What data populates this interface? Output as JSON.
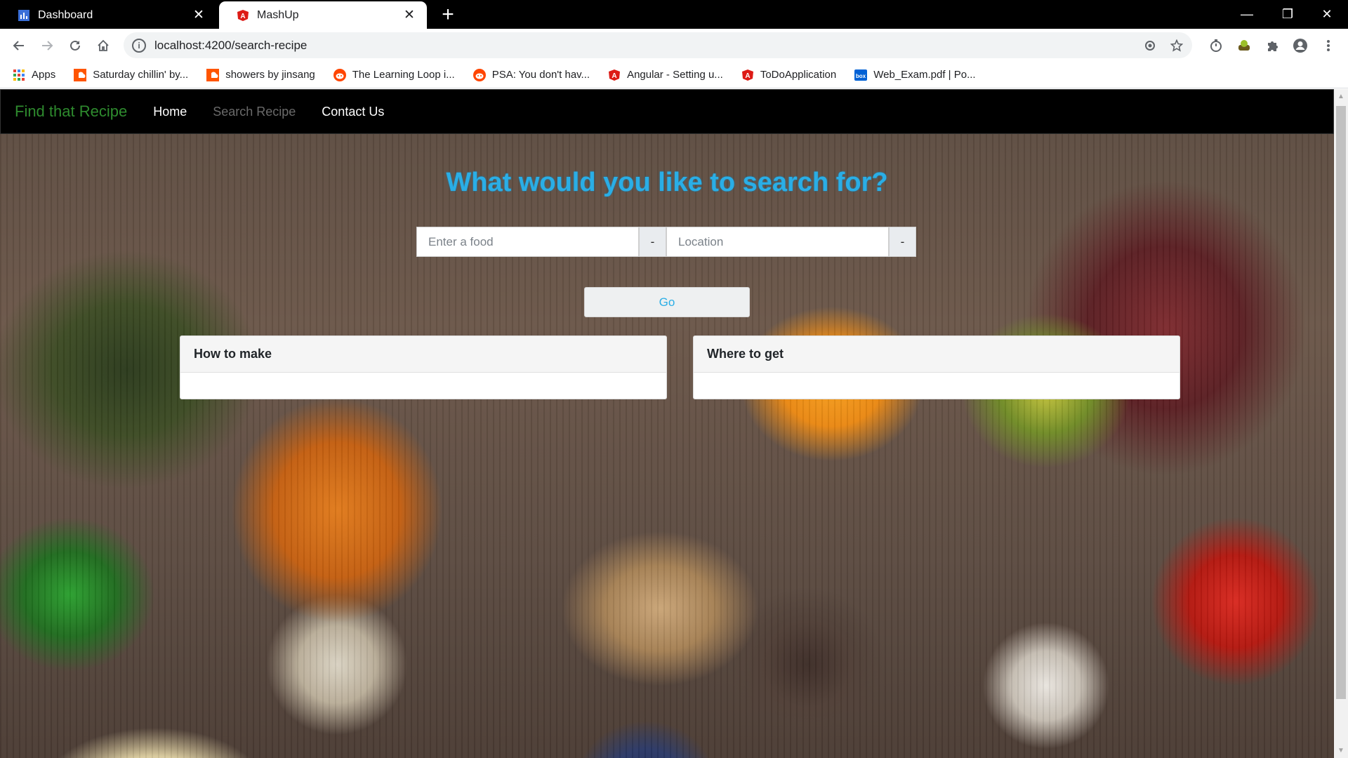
{
  "browser": {
    "tabs": [
      {
        "title": "Dashboard",
        "active": false
      },
      {
        "title": "MashUp",
        "active": true
      }
    ],
    "new_tab_label": "+",
    "url": "localhost:4200/search-recipe",
    "bookmarks": [
      {
        "label": "Apps",
        "icon": "apps-grid-icon"
      },
      {
        "label": "Saturday chillin' by...",
        "icon": "soundcloud-icon"
      },
      {
        "label": "showers by jinsang",
        "icon": "soundcloud-icon"
      },
      {
        "label": "The Learning Loop i...",
        "icon": "reddit-icon"
      },
      {
        "label": "PSA: You don't hav...",
        "icon": "reddit-icon"
      },
      {
        "label": "Angular - Setting u...",
        "icon": "angular-icon"
      },
      {
        "label": "ToDoApplication",
        "icon": "angular-icon"
      },
      {
        "label": "Web_Exam.pdf | Po...",
        "icon": "box-icon"
      }
    ]
  },
  "app": {
    "brand": "Find that Recipe",
    "nav": {
      "home": "Home",
      "search_recipe": "Search Recipe",
      "contact_us": "Contact Us"
    },
    "headline": "What would you like to search for?",
    "food_input": {
      "placeholder": "Enter a food",
      "value": ""
    },
    "location_input": {
      "placeholder": "Location",
      "value": ""
    },
    "dash_label": "-",
    "go_button": "Go",
    "cards": {
      "how_to_make": "How to make",
      "where_to_get": "Where to get"
    }
  },
  "colors": {
    "brand": "#2e8b2e",
    "headline": "#2aaee6",
    "navbar": "#000000"
  }
}
